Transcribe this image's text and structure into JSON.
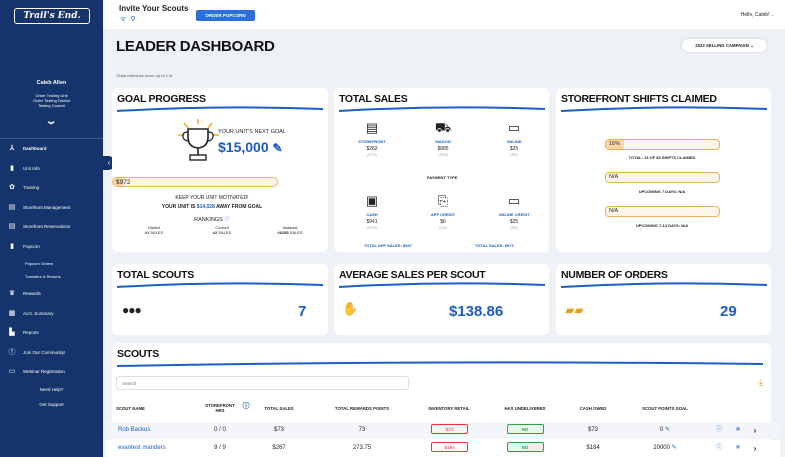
{
  "brand": {
    "logo": "Trail's End."
  },
  "user": {
    "name": "Caleb Allen",
    "unit": "Order Testing Unit",
    "district": "Order Testing District",
    "council": "Testing Council"
  },
  "nav": [
    {
      "label": "Dashboard",
      "icon": "hiker-icon"
    },
    {
      "label": "Unit Info",
      "icon": "info-icon"
    },
    {
      "label": "Training",
      "icon": "training-icon"
    },
    {
      "label": "Storefront Management",
      "icon": "storefront-icon"
    },
    {
      "label": "Storefront Reservations",
      "icon": "storefront-reservations-icon"
    },
    {
      "label": "Popcorn",
      "icon": "popcorn-icon"
    },
    {
      "label": "Popcorn Orders",
      "icon": ""
    },
    {
      "label": "Transfers & Returns",
      "icon": ""
    },
    {
      "label": "Rewards",
      "icon": "trophy-icon"
    },
    {
      "label": "Acct. Summary",
      "icon": "ledger-icon"
    },
    {
      "label": "Reports",
      "icon": "reports-icon"
    },
    {
      "label": "Join Our Community!",
      "icon": "facebook-icon"
    },
    {
      "label": "Webinar Registration",
      "icon": "webinar-icon"
    }
  ],
  "help": {
    "need_help": "Need Help?",
    "support": "Get Support"
  },
  "topbar": {
    "invite": "Invite Your Scouts",
    "order_btn": "ORDER POPCORN",
    "hello": "Hello, Caleb!"
  },
  "header": {
    "title": "LEADER DASHBOARD",
    "campaign": "2022 SELLING CAMPAIGN",
    "refresh_note": "*Data refreshes occur up to 1 hr"
  },
  "goal": {
    "title": "GOAL PROGRESS",
    "next_goal_label": "YOUR UNIT'S NEXT GOAL",
    "next_goal": "$15,000",
    "current": "$972",
    "progress": 0.065,
    "motivate": "KEEP YOUR UNIT MOTIVATED!",
    "away_prefix": "YOUR UNIT IS",
    "away_amount": "$14,028",
    "away_suffix": "AWAY FROM GOAL",
    "rankings_label": "RANKINGS",
    "ranks": [
      {
        "level": "District",
        "rank": "#1",
        "suffix": "SALES"
      },
      {
        "level": "Council",
        "rank": "#2",
        "suffix": "SALES"
      },
      {
        "level": "National",
        "rank": "#6255",
        "suffix": "SALES"
      }
    ]
  },
  "sales": {
    "title": "TOTAL SALES",
    "channels": [
      {
        "label": "STOREFRONT",
        "value": "$262",
        "pct": "(27%)"
      },
      {
        "label": "WAGON",
        "value": "$685",
        "pct": "(70%)"
      },
      {
        "label": "ONLINE",
        "value": "$25",
        "pct": "(3%)"
      }
    ],
    "payment_type_label": "PAYMENT TYPE",
    "payments": [
      {
        "label": "CASH",
        "value": "$941",
        "pct": "(97%)"
      },
      {
        "label": "APP CREDIT",
        "value": "$6",
        "pct": "(1%)"
      },
      {
        "label": "ONLINE CREDIT",
        "value": "$25",
        "pct": "(3%)"
      }
    ],
    "app_total": "TOTAL APP SALES: $947",
    "total": "TOTAL SALES: $972"
  },
  "shifts": {
    "title": "STOREFRONT SHIFTS CLAIMED",
    "items": [
      {
        "value": "16%",
        "label": "TOTAL: 13 OF 83 SHIFTS CLAIMED"
      },
      {
        "value": "N/A",
        "label": "UPCOMING 7 DAYS: N/A"
      },
      {
        "value": "N/A",
        "label": "UPCOMING 7-14 DAYS: N/A"
      }
    ]
  },
  "stats": {
    "total_scouts": {
      "title": "TOTAL SCOUTS",
      "value": "7"
    },
    "avg_sales": {
      "title": "AVERAGE SALES PER SCOUT",
      "value": "$138.86"
    },
    "orders": {
      "title": "NUMBER OF ORDERS",
      "value": "29"
    }
  },
  "scouts": {
    "title": "SCOUTS",
    "search_placeholder": "Search",
    "columns": [
      "SCOUT NAME",
      "STOREFRONT HRS",
      "TOTAL SALES",
      "TOTAL REWARDS POINTS",
      "INVENTORY RETAIL",
      "HAS UNDELIVERED",
      "CASH OWED",
      "SCOUT POINTS GOAL"
    ],
    "rows": [
      {
        "name": "Rob Backus",
        "hrs": "0 / 0",
        "sales": "$73",
        "points": "73",
        "inventory": "-$73",
        "undelivered": "NO",
        "cash_owed": "$73",
        "goal": "0"
      },
      {
        "name": "evantest manders",
        "hrs": "9 / 9",
        "sales": "$267",
        "points": "273.75",
        "inventory": "-$184",
        "undelivered": "NO",
        "cash_owed": "$184",
        "goal": "20000"
      }
    ]
  },
  "colors": {
    "sidebar": "#14346b",
    "accent": "#1a5dc4",
    "button": "#2a6fdb",
    "progress_border": "#e9b35a",
    "negative": "#e33333",
    "positive": "#2e9e4a"
  }
}
